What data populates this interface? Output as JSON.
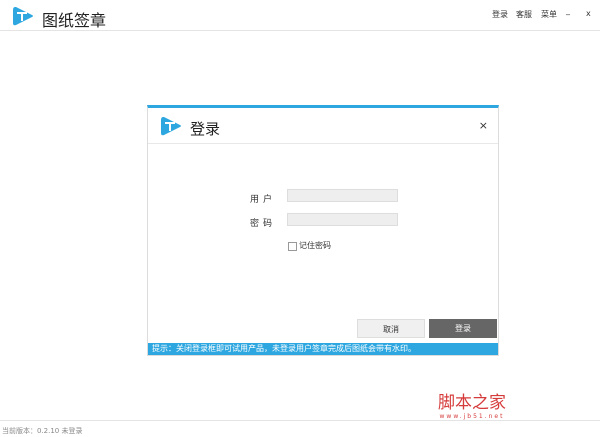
{
  "app": {
    "title": "图纸签章",
    "top_links": [
      "登录",
      "客服",
      "菜单"
    ],
    "minimize": "_",
    "close": "x"
  },
  "dialog": {
    "title": "登录",
    "close": "×",
    "username_label": "用户",
    "password_label": "密码",
    "username_value": "",
    "password_value": "",
    "remember_label": "记住密码",
    "remember_checked": false,
    "cancel_label": "取消",
    "login_label": "登录",
    "tip": "提示：关闭登录框即可试用产品，未登录用户签章完成后图纸会带有水印。"
  },
  "status": {
    "text": "当前版本：0.2.10 未登录"
  },
  "watermark": {
    "name": "脚本之家",
    "url": "www.jb51.net"
  },
  "colors": {
    "accent": "#2ea7e0",
    "login_button": "#666666"
  }
}
